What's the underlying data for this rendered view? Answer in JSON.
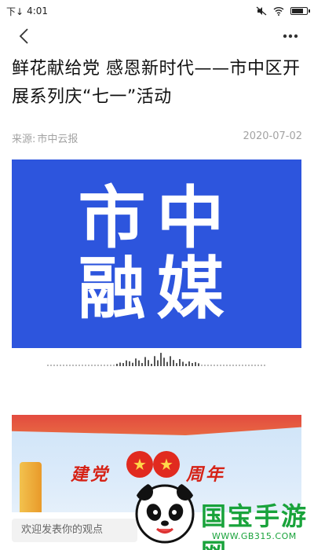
{
  "status_bar": {
    "carrier": "下↓",
    "time": "4:01",
    "battery_level": 0.85
  },
  "nav": {
    "back_icon": "chevron-left-icon",
    "more_icon": "more-dots-icon"
  },
  "article": {
    "title": "鲜花献给党 感恩新时代——市中区开展系列庆“七一”活动",
    "source_label": "来源:",
    "source_name": "市中云报",
    "date": "2020-07-02"
  },
  "banner": {
    "text": "市中\n融媒",
    "background": "#2d55dd"
  },
  "second_image": {
    "caption_start": "建党",
    "caption_end": "周年"
  },
  "comment": {
    "placeholder": "欢迎发表你的观点"
  },
  "watermark": {
    "brand": "国宝手游网",
    "url": "WWW.GB315.COM",
    "color": "#19a33b"
  }
}
